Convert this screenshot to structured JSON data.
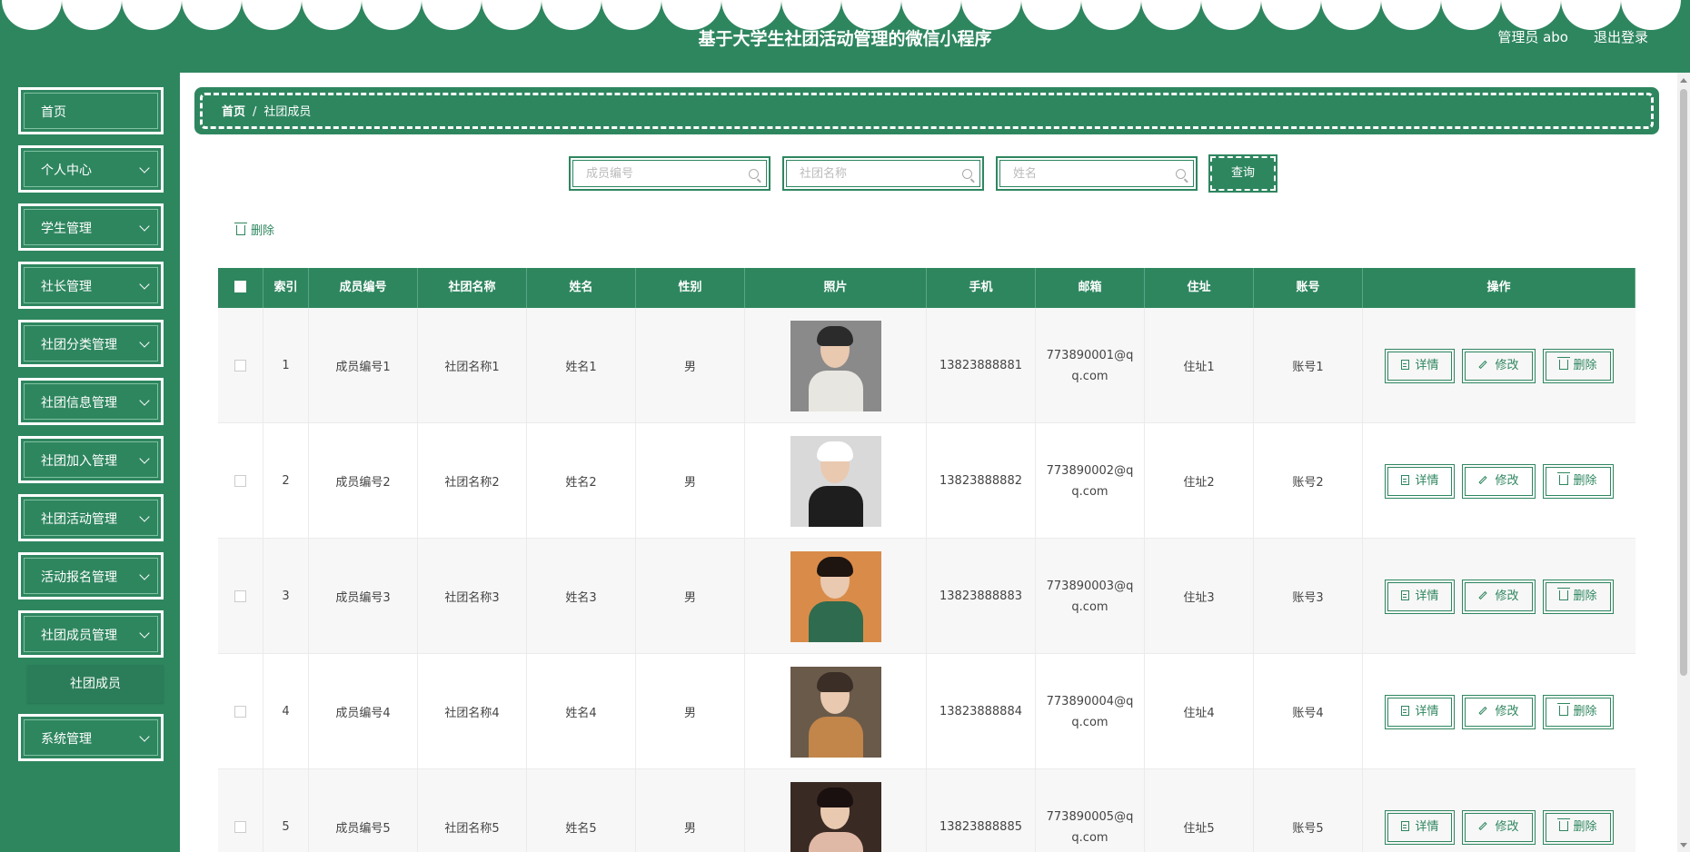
{
  "header": {
    "title": "基于大学生社团活动管理的微信小程序",
    "user": "管理员 abo",
    "logout": "退出登录"
  },
  "sidebar": {
    "items": [
      {
        "label": "首页",
        "has_submenu": false
      },
      {
        "label": "个人中心",
        "has_submenu": true
      },
      {
        "label": "学生管理",
        "has_submenu": true
      },
      {
        "label": "社长管理",
        "has_submenu": true
      },
      {
        "label": "社团分类管理",
        "has_submenu": true
      },
      {
        "label": "社团信息管理",
        "has_submenu": true
      },
      {
        "label": "社团加入管理",
        "has_submenu": true
      },
      {
        "label": "社团活动管理",
        "has_submenu": true
      },
      {
        "label": "活动报名管理",
        "has_submenu": true
      },
      {
        "label": "社团成员管理",
        "has_submenu": true
      },
      {
        "label": "系统管理",
        "has_submenu": true
      }
    ],
    "submenu_active": "社团成员"
  },
  "breadcrumb": {
    "home": "首页",
    "separator": "/",
    "current": "社团成员"
  },
  "search": {
    "member_no_placeholder": "成员编号",
    "club_name_placeholder": "社团名称",
    "name_placeholder": "姓名",
    "query_label": "查询"
  },
  "toolbar": {
    "delete_label": "删除"
  },
  "table": {
    "headers": [
      "索引",
      "成员编号",
      "社团名称",
      "姓名",
      "性别",
      "照片",
      "手机",
      "邮箱",
      "住址",
      "账号",
      "操作"
    ],
    "rows": [
      {
        "index": "1",
        "member_no": "成员编号1",
        "club": "社团名称1",
        "name": "姓名1",
        "gender": "男",
        "phone": "13823888881",
        "email": "773890001@qq.com",
        "address": "住址1",
        "account": "账号1"
      },
      {
        "index": "2",
        "member_no": "成员编号2",
        "club": "社团名称2",
        "name": "姓名2",
        "gender": "男",
        "phone": "13823888882",
        "email": "773890002@qq.com",
        "address": "住址2",
        "account": "账号2"
      },
      {
        "index": "3",
        "member_no": "成员编号3",
        "club": "社团名称3",
        "name": "姓名3",
        "gender": "男",
        "phone": "13823888883",
        "email": "773890003@qq.com",
        "address": "住址3",
        "account": "账号3"
      },
      {
        "index": "4",
        "member_no": "成员编号4",
        "club": "社团名称4",
        "name": "姓名4",
        "gender": "男",
        "phone": "13823888884",
        "email": "773890004@qq.com",
        "address": "住址4",
        "account": "账号4"
      },
      {
        "index": "5",
        "member_no": "成员编号5",
        "club": "社团名称5",
        "name": "姓名5",
        "gender": "男",
        "phone": "13823888885",
        "email": "773890005@qq.com",
        "address": "住址5",
        "account": "账号5"
      }
    ],
    "actions": {
      "detail": "详情",
      "edit": "修改",
      "delete": "删除"
    }
  },
  "colors": {
    "primary": "#2e865f",
    "white": "#ffffff"
  }
}
